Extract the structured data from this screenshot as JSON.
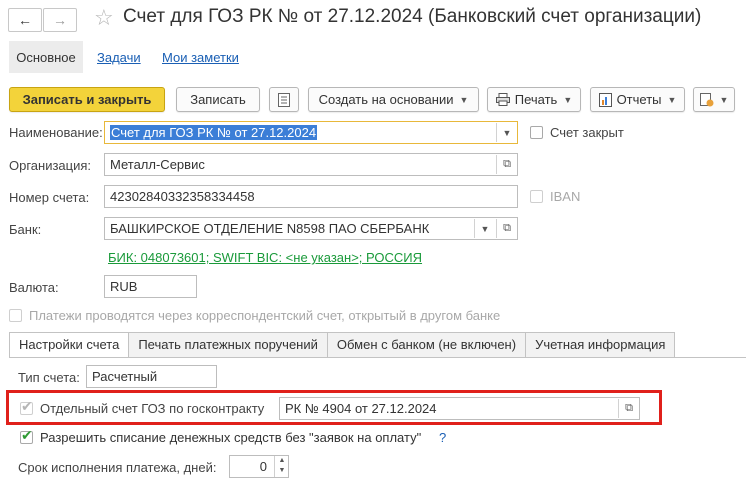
{
  "window": {
    "title": "Счет для ГОЗ РК  № от 27.12.2024 (Банковский счет организации)"
  },
  "nav": {
    "main_tab": "Основное",
    "links": [
      "Задачи",
      "Мои заметки"
    ]
  },
  "toolbar": {
    "save_close": "Записать и закрыть",
    "save": "Записать",
    "create_based": "Создать на основании",
    "print": "Печать",
    "reports": "Отчеты"
  },
  "form": {
    "name_label": "Наименование:",
    "name_value": "Счет для ГОЗ РК  № от 27.12.2024",
    "closed_label": "Счет закрыт",
    "org_label": "Организация:",
    "org_value": "Металл-Сервис",
    "account_label": "Номер счета:",
    "account_value": "42302840332358334458",
    "iban_label": "IBAN",
    "bank_label": "Банк:",
    "bank_value": "БАШКИРСКОЕ ОТДЕЛЕНИЕ N8598 ПАО СБЕРБАНК",
    "bank_info": "БИК: 048073601; SWIFT BIC: <не указан>; РОССИЯ",
    "currency_label": "Валюта:",
    "currency_value": "RUB",
    "corr_label": "Платежи проводятся через корреспондентский счет, открытый в другом банке"
  },
  "tabs": [
    "Настройки счета",
    "Печать платежных поручений",
    "Обмен с банком (не включен)",
    "Учетная информация"
  ],
  "settings": {
    "type_label": "Тип счета:",
    "type_value": "Расчетный",
    "goz_label": "Отдельный счет ГОЗ по госконтракту",
    "goz_value": "РК № 4904 от 27.12.2024",
    "allow_label": "Разрешить списание денежных средств без \"заявок на оплату\"",
    "help": "?",
    "term_label": "Срок исполнения платежа, дней:",
    "term_value": "0"
  },
  "colors": {
    "accent_yellow": "#f3d33a",
    "highlight_red": "#e0201b",
    "link_blue": "#1a5fb4",
    "link_green": "#1a9a3a",
    "check_green": "#2e9a33"
  }
}
